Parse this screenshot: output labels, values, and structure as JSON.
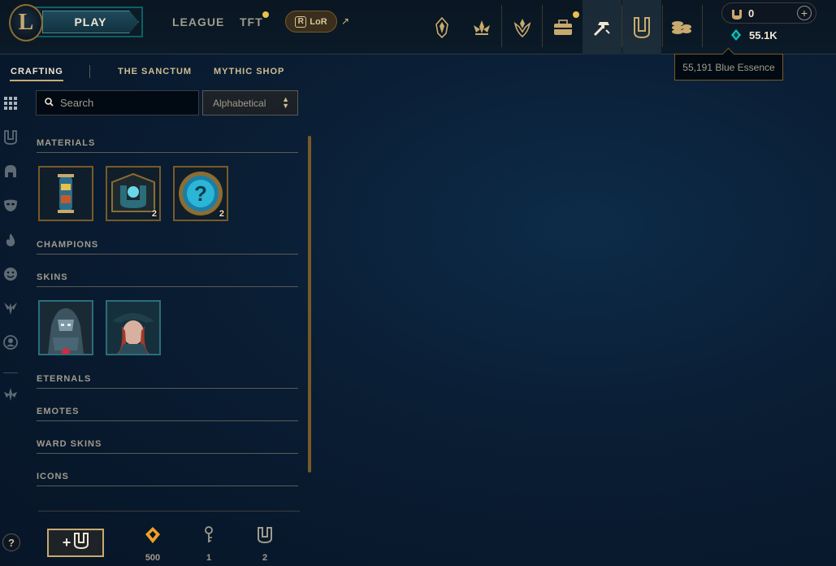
{
  "header": {
    "logo_letter": "L",
    "play_label": "PLAY",
    "nav": {
      "league": "LEAGUE",
      "tft": "TFT",
      "lor_label": "LoR",
      "lor_badge": "R",
      "external_glyph": "↗"
    },
    "top_icons": [
      "clash-icon",
      "profile-crest-icon",
      "ranked-icon",
      "missions-icon",
      "crafting-icon",
      "collection-icon",
      "store-icon"
    ],
    "currency": {
      "rp_value": "0",
      "plus_glyph": "+",
      "be_value": "55.1K"
    },
    "tooltip": "55,191 Blue Essence"
  },
  "subtabs": {
    "crafting": "CRAFTING",
    "sanctum": "THE SANCTUM",
    "mythic": "MYTHIC SHOP"
  },
  "rail_icons": [
    "grid-icon",
    "chest-icon",
    "helmet-icon",
    "mask-icon",
    "flame-icon",
    "smiley-icon",
    "ward-icon",
    "portrait-icon",
    "emblem-icon"
  ],
  "help_label": "?",
  "search": {
    "placeholder": "Search"
  },
  "sort": {
    "selected": "Alphabetical",
    "arrows": "▲▼"
  },
  "sections": {
    "materials": {
      "title": "MATERIALS",
      "items": [
        {
          "name": "capsule",
          "count": ""
        },
        {
          "name": "hextech-chest",
          "count": "2"
        },
        {
          "name": "mystery-orb",
          "count": "2"
        }
      ]
    },
    "champions": {
      "title": "CHAMPIONS"
    },
    "skins": {
      "title": "SKINS",
      "items": [
        {
          "name": "skin-shard-1",
          "count": ""
        },
        {
          "name": "skin-shard-2",
          "count": ""
        }
      ]
    },
    "eternals": {
      "title": "ETERNALS"
    },
    "emotes": {
      "title": "EMOTES"
    },
    "ward_skins": {
      "title": "WARD SKINS"
    },
    "icons": {
      "title": "ICONS"
    }
  },
  "footer": {
    "add_plus": "+",
    "orange_essence": "500",
    "keys": "1",
    "chests": "2"
  },
  "colors": {
    "gold": "#c8aa6e",
    "accent_teal": "#0d5e66",
    "blue_essence": "#0ac8b9",
    "orange_essence": "#f0a224",
    "notification": "#e8c04c"
  }
}
